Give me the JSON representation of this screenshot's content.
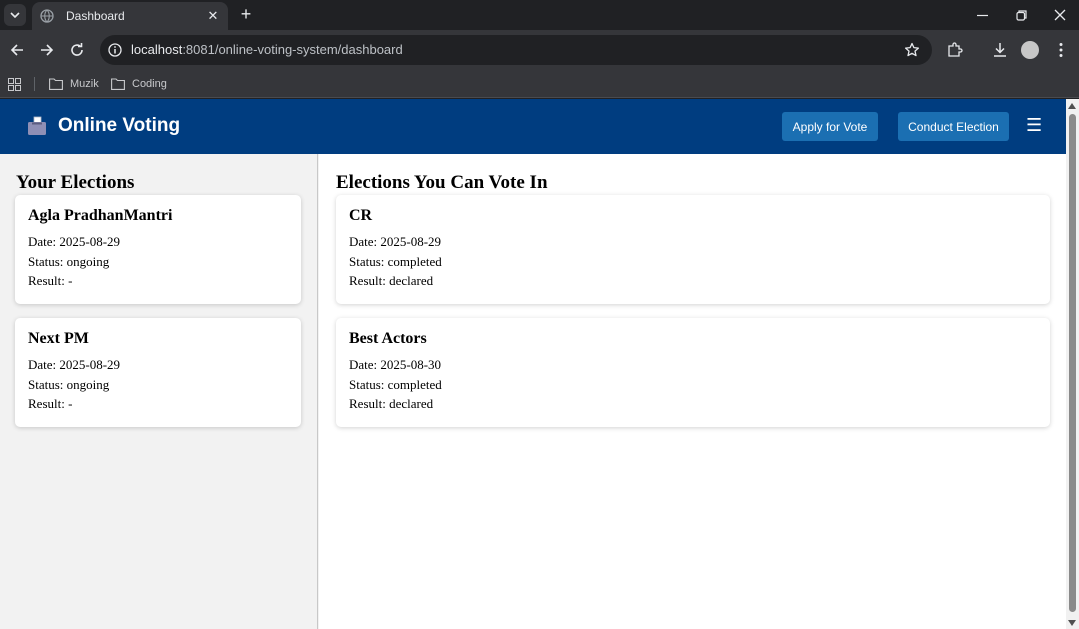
{
  "browser": {
    "tab_title": "Dashboard",
    "url_host": "localhost",
    "url_rest": ":8081/online-voting-system/dashboard",
    "bookmarks": [
      {
        "label": "Muzik"
      },
      {
        "label": "Coding"
      }
    ]
  },
  "header": {
    "app_name": "Online Voting",
    "apply_button": "Apply for Vote",
    "conduct_button": "Conduct Election",
    "menu_glyph": "☰",
    "colors": {
      "bar": "#003d80",
      "button": "#1b6fb2"
    }
  },
  "your_elections": {
    "title": "Your Elections",
    "items": [
      {
        "name": "Agla PradhanMantri",
        "date": "Date: 2025-08-29",
        "status": "Status: ongoing",
        "result": "Result: -"
      },
      {
        "name": "Next PM",
        "date": "Date: 2025-08-29",
        "status": "Status: ongoing",
        "result": "Result: -"
      }
    ]
  },
  "vote_elections": {
    "title": "Elections You Can Vote In",
    "items": [
      {
        "name": "CR",
        "date": "Date: 2025-08-29",
        "status": "Status: completed",
        "result": "Result: declared"
      },
      {
        "name": "Best Actors",
        "date": "Date: 2025-08-30",
        "status": "Status: completed",
        "result": "Result: declared"
      }
    ]
  }
}
